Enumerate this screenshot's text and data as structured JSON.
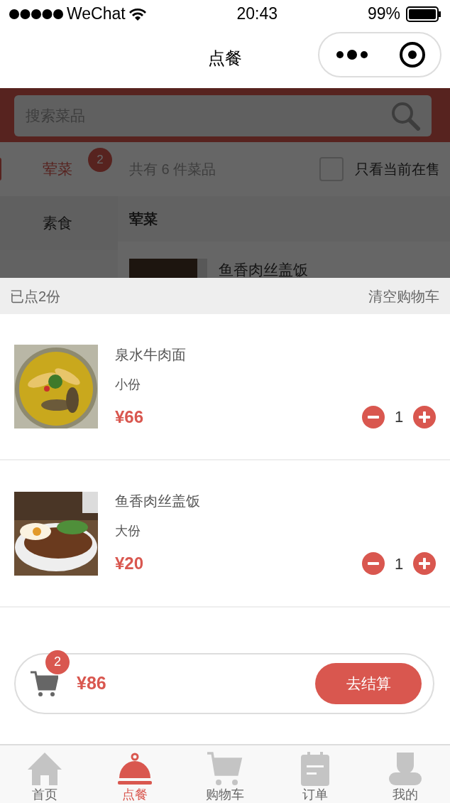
{
  "status_bar": {
    "carrier": "WeChat",
    "time": "20:43",
    "battery": "99%"
  },
  "nav": {
    "title": "点餐"
  },
  "search": {
    "placeholder": "搜索菜品"
  },
  "categories": [
    {
      "name": "荤菜",
      "selected": true,
      "badge": "2"
    },
    {
      "name": "素食",
      "selected": false
    }
  ],
  "menu": {
    "summary": "共有 6 件菜品",
    "filter": {
      "label": "只看当前在售",
      "checked": false
    },
    "section_title": "荤菜",
    "dishes": [
      {
        "name": "鱼香肉丝盖饭"
      }
    ]
  },
  "cart": {
    "count_text": "已点2份",
    "clear": "清空购物车",
    "items": [
      {
        "name": "泉水牛肉面",
        "size": "小份",
        "price": "¥66",
        "quantity": "1"
      },
      {
        "name": "鱼香肉丝盖饭",
        "size": "大份",
        "price": "¥20",
        "quantity": "1"
      }
    ]
  },
  "checkout": {
    "badge": "2",
    "total": "¥86",
    "button": "去结算"
  },
  "tabs": [
    {
      "label": "首页",
      "selected": false
    },
    {
      "label": "点餐",
      "selected": true
    },
    {
      "label": "购物车",
      "selected": false
    },
    {
      "label": "订单",
      "selected": false
    },
    {
      "label": "我的",
      "selected": false
    }
  ]
}
